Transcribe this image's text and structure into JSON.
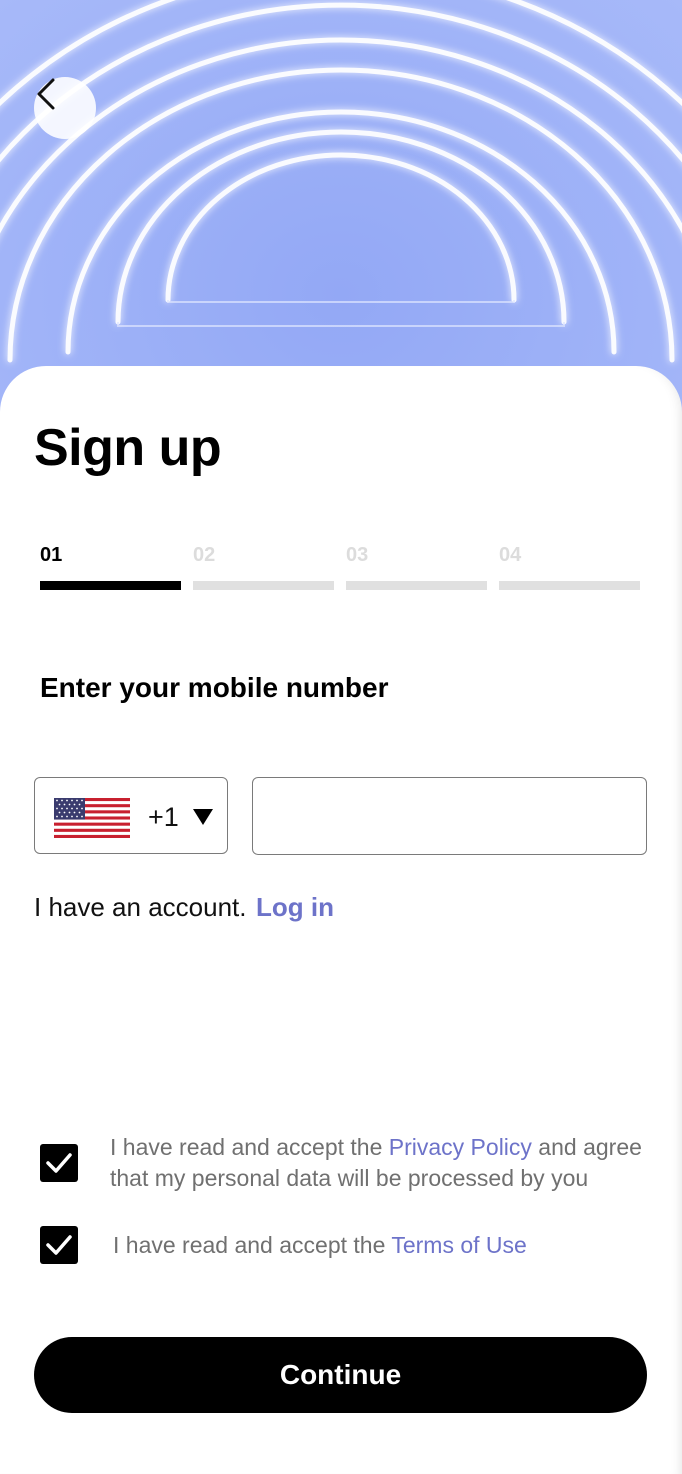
{
  "header": {
    "back_icon": "chevron-left-icon"
  },
  "form": {
    "title": "Sign up",
    "steps": [
      {
        "label": "01",
        "active": true
      },
      {
        "label": "02",
        "active": false
      },
      {
        "label": "03",
        "active": false
      },
      {
        "label": "04",
        "active": false
      }
    ],
    "subtitle": "Enter your mobile number",
    "country": {
      "flag_icon": "us-flag-icon",
      "dial_code": "+1",
      "caret_icon": "triangle-down-icon"
    },
    "phone": {
      "value": "",
      "placeholder": ""
    },
    "account_prompt": "I have an account.",
    "login_label": "Log in",
    "consents": [
      {
        "checked": true,
        "prefix": "I have read and accept the ",
        "link": "Privacy Policy",
        "suffix": " and agree that my personal data will be processed by you"
      },
      {
        "checked": true,
        "prefix": "I have read and accept the ",
        "link": "Terms of Use",
        "suffix": ""
      }
    ],
    "continue_label": "Continue"
  },
  "colors": {
    "accent_link": "#6d73c9",
    "hero_blue": "#9cb0f7",
    "primary_button": "#000000"
  }
}
